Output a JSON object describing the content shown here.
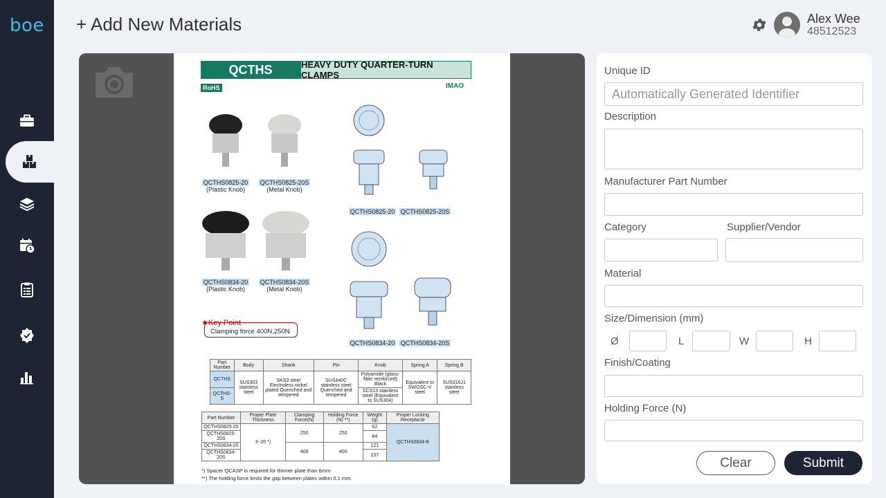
{
  "app": {
    "logo": "boe"
  },
  "header": {
    "title": "+ Add New Materials"
  },
  "user": {
    "name": "Alex Wee",
    "id": "48512523"
  },
  "sidebar": {
    "items": [
      {
        "icon": "briefcase-icon",
        "active": false
      },
      {
        "icon": "boxes-icon",
        "active": true
      },
      {
        "icon": "layers-icon",
        "active": false
      },
      {
        "icon": "calendar-clock-icon",
        "active": false
      },
      {
        "icon": "clipboard-list-icon",
        "active": false
      },
      {
        "icon": "badge-check-icon",
        "active": false
      },
      {
        "icon": "bar-chart-icon",
        "active": false
      }
    ]
  },
  "document": {
    "code": "QCTHS",
    "heading": "HEAVY DUTY QUARTER-TURN CLAMPS",
    "rohs": "RoHS",
    "brand": "IMAO",
    "products": [
      {
        "part": "QCTHS0825-20",
        "knob": "(Plastic Knob)"
      },
      {
        "part": "QCTHS0825-20S",
        "knob": "(Metal Knob)"
      },
      {
        "part": "QCTHS0834-20",
        "knob": "(Plastic Knob)"
      },
      {
        "part": "QCTHS0834-20S",
        "knob": "(Metal Knob)"
      }
    ],
    "drawing_labels": [
      {
        "a": "QCTHS0825-20",
        "b": "QCTHS0825-20S"
      },
      {
        "a": "QCTHS0834-20",
        "b": "QCTHS0834-20S"
      }
    ],
    "key_point_title": "★Key Point",
    "key_point_text": "Clamping force 400N,250N",
    "material_table": {
      "headers": [
        "Part Number",
        "Body",
        "Shank",
        "Pin",
        "Knob",
        "Spring A",
        "Spring B"
      ],
      "row1": [
        "QCTHS",
        "SUS303 stainless steel",
        "SKS3 steel Electroless nickel plated Quenched and tempered",
        "SUS440C stainless steel Quenched and tempered",
        "Polyamide (glass-fiber reinforced) Black",
        "Equivalent to SWOSC-V steel",
        "SUS316J1 stainless steel"
      ],
      "row2_part": "QCTHS-S",
      "row2_knob": "SCS13 stainless steel (Equivalent to SUS304)"
    },
    "spec_table": {
      "headers": [
        "Part Number",
        "Proper Plate Thickness",
        "Clamping Force(N)",
        "Holding Force (N) **)",
        "Weight (g)",
        "Proper Locking Receptacle"
      ],
      "parts": [
        "QCTHS0825-20",
        "QCTHS0825-20S",
        "QCTHS0834-20",
        "QCTHS0834-20S"
      ],
      "thickness": "3~20 *)",
      "clamp": [
        "250",
        "400"
      ],
      "hold": [
        "250",
        "400"
      ],
      "weights": [
        "62",
        "84",
        "121",
        "157"
      ],
      "receptacle": "QCTHS0834-B"
    },
    "notes": [
      "*) Spacer QCASP is required for thinner plate than 6mm.",
      "**) The holding force limits the gap between plates within 0.1 mm."
    ]
  },
  "form": {
    "unique_id": {
      "label": "Unique ID",
      "placeholder": "Automatically Generated Identifier"
    },
    "description": {
      "label": "Description"
    },
    "mpn": {
      "label": "Manufacturer Part Number"
    },
    "category": {
      "label": "Category"
    },
    "supplier": {
      "label": "Supplier/Vendor"
    },
    "material": {
      "label": "Material"
    },
    "size": {
      "label": "Size/Dimension (mm)",
      "dims": [
        "Ø",
        "L",
        "W",
        "H"
      ]
    },
    "finish": {
      "label": "Finish/Coating"
    },
    "holding_force": {
      "label": "Holding Force (N)"
    },
    "clear_label": "Clear",
    "submit_label": "Submit"
  }
}
